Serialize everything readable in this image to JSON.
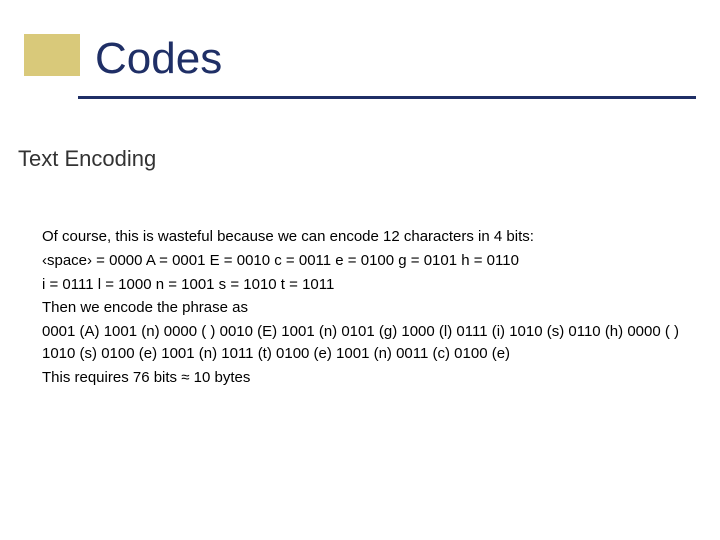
{
  "title": "Codes",
  "subtitle": "Text Encoding",
  "body": {
    "p1": "Of course, this is wasteful because we can encode 12 characters in 4 bits:",
    "p2": "‹space› = 0000   A = 0001   E = 0010   c = 0011   e = 0100  g = 0101   h = 0110",
    "p3": "i = 0111   l = 1000   n = 1001   s = 1010   t = 1011",
    "p4": "Then we encode the phrase as",
    "p5": "0001 (A)   1001 (n)   0000 ( )   0010 (E)   1001 (n)   0101 (g)   1000 (l)   0111 (i)   1010 (s)   0110 (h)   0000 ( )   1010 (s)   0100 (e)   1001 (n)   1011 (t)   0100 (e)   1001 (n)   0011 (c)   0100 (e)",
    "p6": "This requires 76 bits ≈ 10 bytes"
  }
}
